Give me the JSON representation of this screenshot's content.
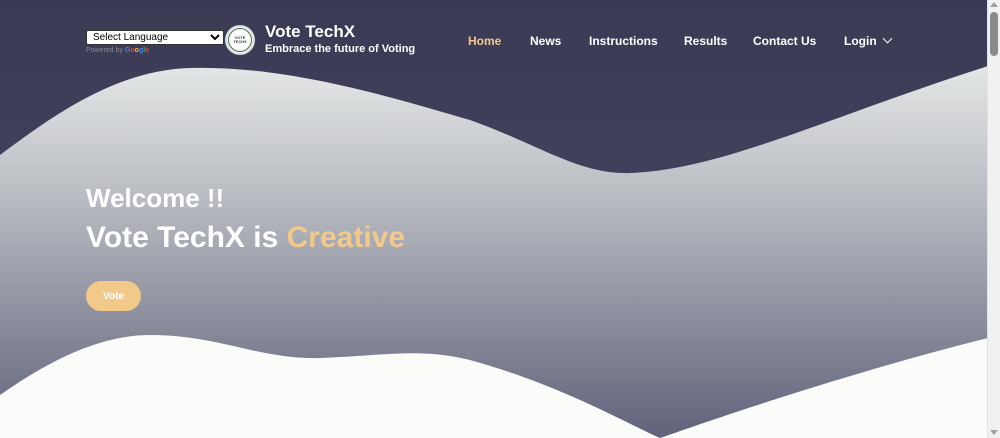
{
  "colors": {
    "background": "#3f3f5b",
    "accent": "#f3c98a",
    "text": "#ffffff"
  },
  "translate": {
    "selected": "Select Language",
    "powered_by": "Powered by",
    "google": [
      "G",
      "o",
      "o",
      "g",
      "l",
      "e"
    ]
  },
  "brand": {
    "logo_text": "VOTE TECHX",
    "title": "Vote TechX",
    "tagline": "Embrace the future of Voting"
  },
  "nav": {
    "items": [
      {
        "label": "Home",
        "active": true
      },
      {
        "label": "News"
      },
      {
        "label": "Instructions"
      },
      {
        "label": "Results"
      },
      {
        "label": "Contact Us"
      },
      {
        "label": "Login",
        "icon": "chevron-down-icon"
      }
    ]
  },
  "hero": {
    "welcome": "Welcome !!",
    "headline_prefix": "Vote TechX is ",
    "headline_accent": "Creative",
    "vote_button": "Vote"
  }
}
